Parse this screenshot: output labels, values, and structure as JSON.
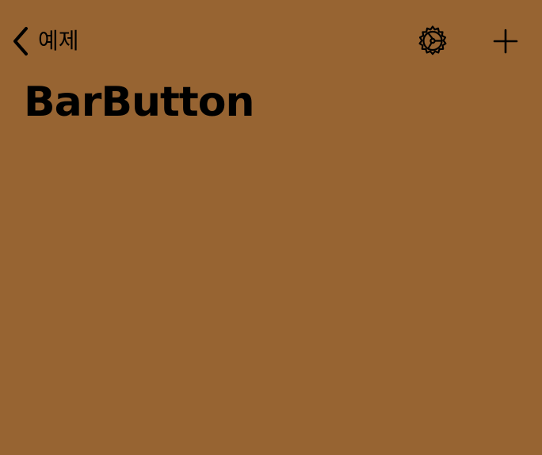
{
  "navigation": {
    "back_label": "예제",
    "icons": {
      "back": "chevron-left-icon",
      "settings": "gear-icon",
      "add": "plus-icon"
    }
  },
  "page": {
    "title": "BarButton",
    "background_color": "#976432",
    "tint_color": "#000000"
  }
}
